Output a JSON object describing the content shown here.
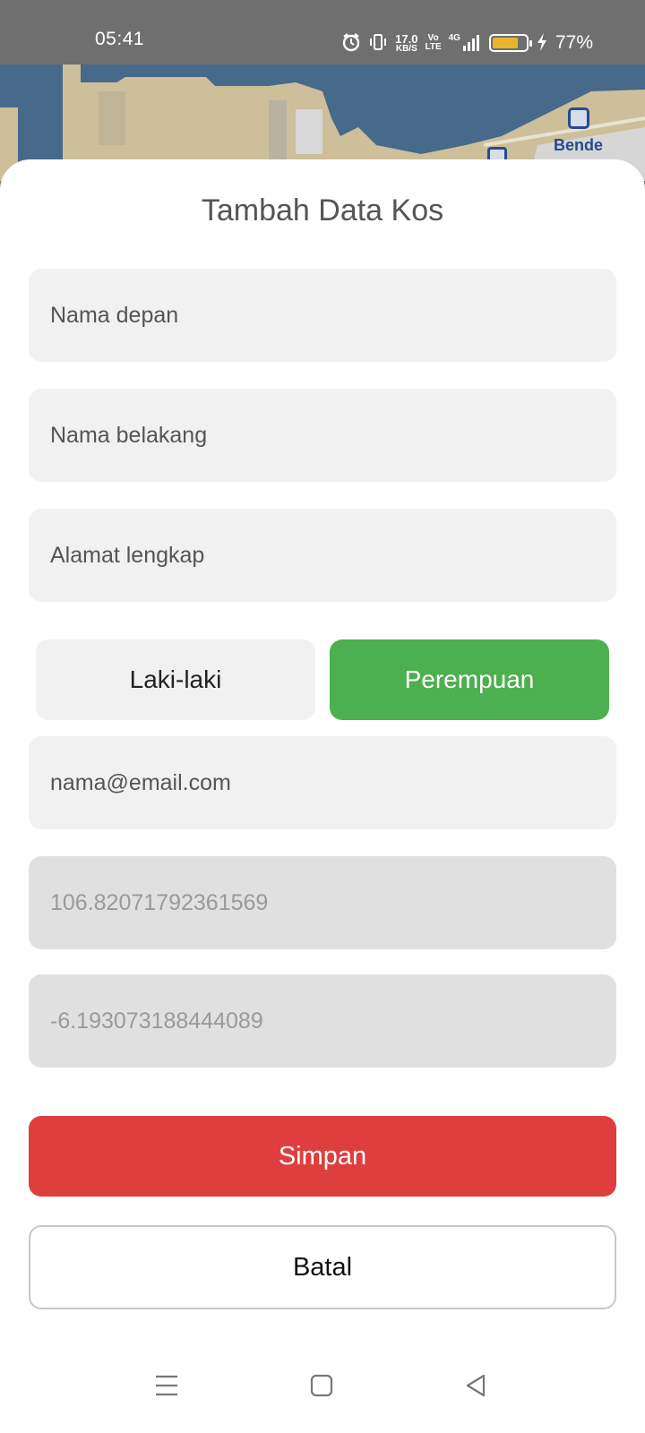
{
  "status_bar": {
    "time": "05:41",
    "net_speed_value": "17.0",
    "net_speed_unit": "KB/S",
    "volte_top": "Vo",
    "volte_bottom": "LTE",
    "network": "4G",
    "battery_level": 0.77,
    "battery_percent": "77%",
    "icons": [
      "alarm-icon",
      "vibrate-icon",
      "signal-icon",
      "battery-icon",
      "charging-icon"
    ]
  },
  "map": {
    "place_label": "Bende",
    "colors": {
      "water": "#47698a",
      "land": "#cdbf9a"
    }
  },
  "form": {
    "title": "Tambah Data Kos",
    "first_name_placeholder": "Nama depan",
    "last_name_placeholder": "Nama belakang",
    "address_placeholder": "Alamat lengkap",
    "gender_options": [
      "Laki-laki",
      "Perempuan"
    ],
    "gender_selected": "Perempuan",
    "email_placeholder": "nama@email.com",
    "longitude_value": "106.82071792361569",
    "latitude_value": "-6.193073188444089",
    "save_label": "Simpan",
    "cancel_label": "Batal",
    "colors": {
      "selected": "#4caf50",
      "save": "#de3e3e"
    }
  },
  "nav_bar": {
    "icons": [
      "menu-icon",
      "home-icon",
      "back-icon"
    ]
  }
}
